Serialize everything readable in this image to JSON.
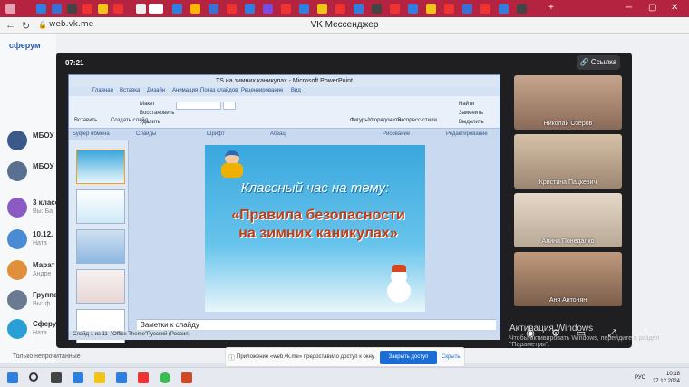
{
  "browser": {
    "url": "web.vk.me",
    "window_title": "VK Мессенджер"
  },
  "vk": {
    "logo_text": "сферум",
    "chats": [
      {
        "name": "МБОУ",
        "subtitle": ""
      },
      {
        "name": "МБОУ",
        "subtitle": ""
      },
      {
        "name": "3 класс",
        "subtitle": "Вы: Ба"
      },
      {
        "name": "10.12.",
        "subtitle": "Ната"
      },
      {
        "name": "Марат",
        "subtitle": "Андре"
      },
      {
        "name": "Группа",
        "subtitle": "Вы: ф"
      },
      {
        "name": "Сферу",
        "subtitle": "Ната"
      }
    ],
    "bottom_link": "Только непрочитанные"
  },
  "call": {
    "timer": "07:21",
    "link_button": "Ссылка",
    "participants": [
      {
        "name": "Николай Озеров"
      },
      {
        "name": "Кристина Пацкевич"
      },
      {
        "name": "Алина Понедалко"
      },
      {
        "name": "Аня Антонян"
      }
    ],
    "windows_activation_title": "Активация Windows",
    "windows_activation_text": "Чтобы активировать Windows, перейдите в раздел \"Параметры\".",
    "share_message": "Приложение «web.vk.me» предоставило доступ к окну.",
    "share_stop": "Закрыть доступ",
    "share_hide": "Скрыть"
  },
  "powerpoint": {
    "title": "TS на зимних каникулах - Microsoft PowerPoint",
    "tabs": [
      "Главная",
      "Вставка",
      "Дизайн",
      "Анимация",
      "Показ слайдов",
      "Рецензирование",
      "Вид"
    ],
    "groups": [
      "Буфер обмена",
      "Слайды",
      "Шрифт",
      "Абзац",
      "Рисование",
      "Редактирование"
    ],
    "ribbon_buttons": [
      "Вставить",
      "Создать слайд",
      "Макет",
      "Восстановить",
      "Удалить",
      "Фигуры",
      "Упорядочить",
      "Экспресс-стили",
      "Найти",
      "Заменить",
      "Выделить"
    ],
    "slide_line1": "Классный час на тему:",
    "slide_line2": "«Правила безопасности на зимних каникулах»",
    "notes": "Заметки к слайду",
    "status": [
      "Слайд 1 из 11",
      "\"Office Theme\"",
      "Русский (Россия)"
    ]
  },
  "taskbar": {
    "lang": "РУС",
    "time": "10:18",
    "date": "27.12.2024"
  }
}
